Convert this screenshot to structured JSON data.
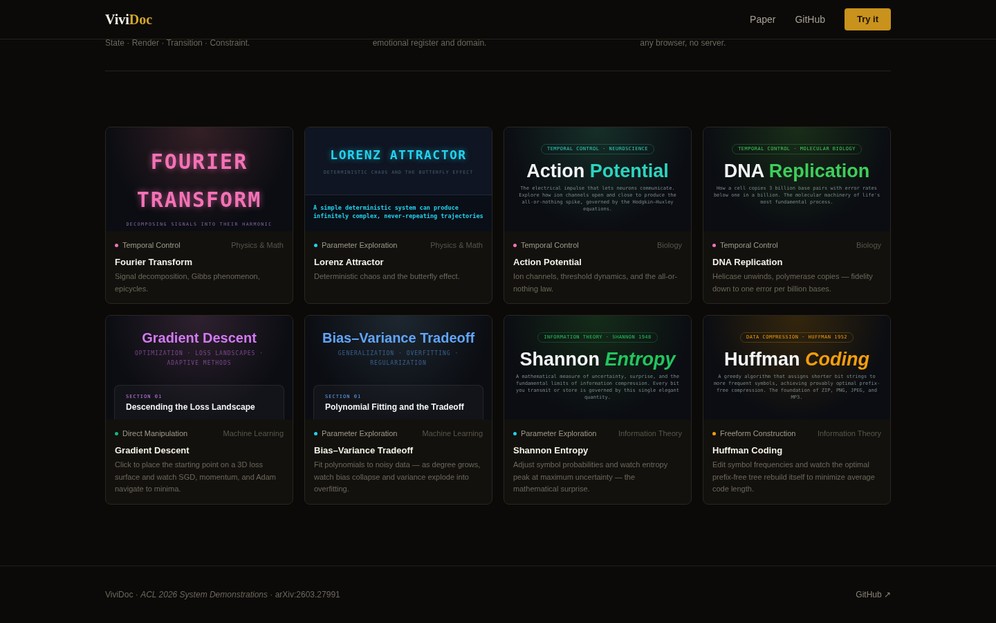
{
  "header": {
    "logo": {
      "first": "Vivi",
      "second": "Doc"
    },
    "links": [
      "Paper",
      "GitHub"
    ],
    "cta": "Try it"
  },
  "strip": [
    "State · Render · Transition · Constraint.",
    "emotional register and domain.",
    "any browser, no server."
  ],
  "cards": [
    {
      "preview": {
        "kind": "poster",
        "color": "#f472b6",
        "title": "FOURIER TRANSFORM",
        "subtitle": "DECOMPOSING SIGNALS INTO THEIR HARMONIC"
      },
      "mode": {
        "label": "Temporal Control",
        "color": "#f472b6"
      },
      "category": "Physics & Math",
      "title": "Fourier Transform",
      "description": "Signal decomposition, Gibbs phenomenon, epicycles."
    },
    {
      "preview": {
        "kind": "terminal",
        "color": "#22d3ee",
        "title": "LORENZ ATTRACTOR",
        "subtitle": "DETERMINISTIC CHAOS AND THE BUTTERFLY EFFECT",
        "text": "A simple deterministic system can produce infinitely complex, never-repeating trajectories"
      },
      "mode": {
        "label": "Parameter Exploration",
        "color": "#22d3ee"
      },
      "category": "Physics & Math",
      "title": "Lorenz Attractor",
      "description": "Deterministic chaos and the butterfly effect."
    },
    {
      "preview": {
        "kind": "hero",
        "color": "#2dd4bf",
        "tag": "TEMPORAL CONTROL · NEUROSCIENCE",
        "title_plain": "Action",
        "title_accent": "Potential",
        "accent_italic": false,
        "text": "The electrical impulse that lets neurons communicate. Explore how ion channels open and close to produce the all-or-nothing spike, governed by the Hodgkin–Huxley equations."
      },
      "mode": {
        "label": "Temporal Control",
        "color": "#f472b6"
      },
      "category": "Biology",
      "title": "Action Potential",
      "description": "Ion channels, threshold dynamics, and the all-or-nothing law."
    },
    {
      "preview": {
        "kind": "hero",
        "color": "#3ecf5a",
        "tag": "TEMPORAL CONTROL · MOLECULAR BIOLOGY",
        "title_plain": "DNA",
        "title_accent": "Replication",
        "accent_italic": false,
        "text": "How a cell copies 3 billion base pairs with error rates below one in a billion. The molecular machinery of life's most fundamental process."
      },
      "mode": {
        "label": "Temporal Control",
        "color": "#f472b6"
      },
      "category": "Biology",
      "title": "DNA Replication",
      "description": "Helicase unwinds, polymerase copies — fidelity down to one error per billion bases."
    },
    {
      "preview": {
        "kind": "doc",
        "color": "#d379f5",
        "title": "Gradient Descent",
        "subtitle": "OPTIMIZATION · LOSS LANDSCAPES · ADAPTIVE METHODS",
        "section_label": "SECTION 01",
        "section_title": "Descending the Loss Landscape"
      },
      "mode": {
        "label": "Direct Manipulation",
        "color": "#10b981"
      },
      "category": "Machine Learning",
      "title": "Gradient Descent",
      "description": "Click to place the starting point on a 3D loss surface and watch SGD, momentum, and Adam navigate to minima."
    },
    {
      "preview": {
        "kind": "doc",
        "color": "#60a5fa",
        "title": "Bias–Variance Tradeoff",
        "subtitle": "GENERALIZATION · OVERFITTING · REGULARIZATION",
        "section_label": "SECTION 01",
        "section_title": "Polynomial Fitting and the Tradeoff"
      },
      "mode": {
        "label": "Parameter Exploration",
        "color": "#22d3ee"
      },
      "category": "Machine Learning",
      "title": "Bias–Variance Tradeoff",
      "description": "Fit polynomials to noisy data — as degree grows, watch bias collapse and variance explode into overfitting."
    },
    {
      "preview": {
        "kind": "hero",
        "color": "#22c55e",
        "tag": "INFORMATION THEORY · SHANNON 1948",
        "title_plain": "Shannon",
        "title_accent": "Entropy",
        "accent_italic": true,
        "text": "A mathematical measure of uncertainty, surprise, and the fundamental limits of information compression. Every bit you transmit or store is governed by this single elegant quantity."
      },
      "mode": {
        "label": "Parameter Exploration",
        "color": "#22d3ee"
      },
      "category": "Information Theory",
      "title": "Shannon Entropy",
      "description": "Adjust symbol probabilities and watch entropy peak at maximum uncertainty — the mathematical surprise."
    },
    {
      "preview": {
        "kind": "hero",
        "color": "#f59e0b",
        "tag": "DATA COMPRESSION · HUFFMAN 1952",
        "title_plain": "Huffman",
        "title_accent": "Coding",
        "accent_italic": true,
        "text": "A greedy algorithm that assigns shorter bit strings to more frequent symbols, achieving provably optimal prefix-free compression. The foundation of ZIP, PNG, JPEG, and MP3."
      },
      "mode": {
        "label": "Freeform Construction",
        "color": "#f59e0b"
      },
      "category": "Information Theory",
      "title": "Huffman Coding",
      "description": "Edit symbol frequencies and watch the optimal prefix-free tree rebuild itself to minimize average code length."
    }
  ],
  "footer": {
    "citation": "ViviDoc · *ACL 2026 System Demonstrations* · arXiv:2603.27991",
    "link": "GitHub ↗"
  }
}
